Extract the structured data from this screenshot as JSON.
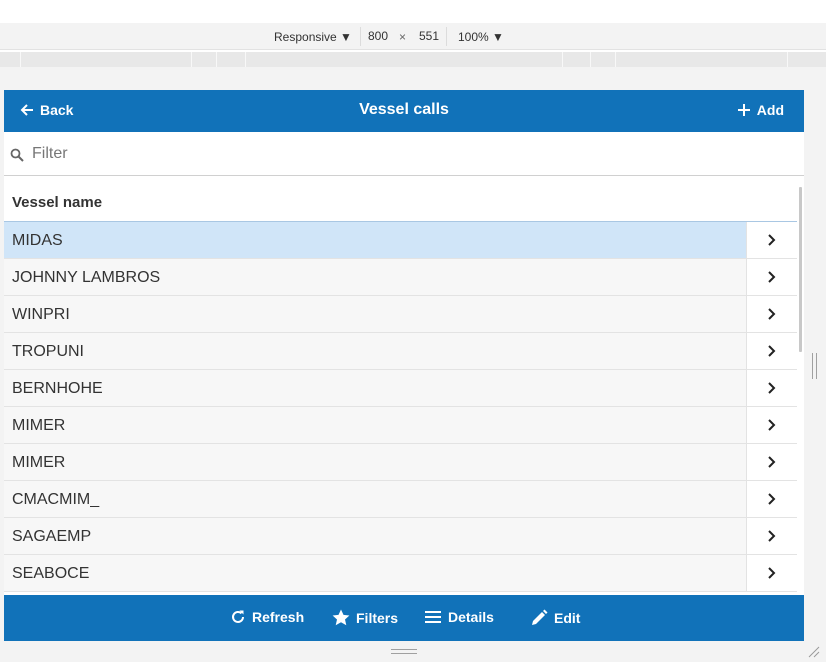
{
  "devtools": {
    "device": "Responsive",
    "width": "800",
    "times": "×",
    "height": "551",
    "zoom": "100%"
  },
  "header": {
    "back_label": "Back",
    "title": "Vessel calls",
    "add_label": "Add"
  },
  "filter": {
    "placeholder": "Filter",
    "value": ""
  },
  "list": {
    "column_header": "Vessel name",
    "selected_index": 0,
    "rows": [
      {
        "label": "MIDAS"
      },
      {
        "label": "JOHNNY LAMBROS"
      },
      {
        "label": "WINPRI"
      },
      {
        "label": "TROPUNI"
      },
      {
        "label": "BERNHOHE"
      },
      {
        "label": "MIMER"
      },
      {
        "label": "MIMER"
      },
      {
        "label": "CMACMIM_"
      },
      {
        "label": "SAGAEMP"
      },
      {
        "label": "SEABOCE"
      }
    ]
  },
  "footer": {
    "refresh_label": "Refresh",
    "filters_label": "Filters",
    "details_label": "Details",
    "edit_label": "Edit"
  },
  "colors": {
    "brand": "#1172b9",
    "selected_row": "#d0e5f8"
  }
}
